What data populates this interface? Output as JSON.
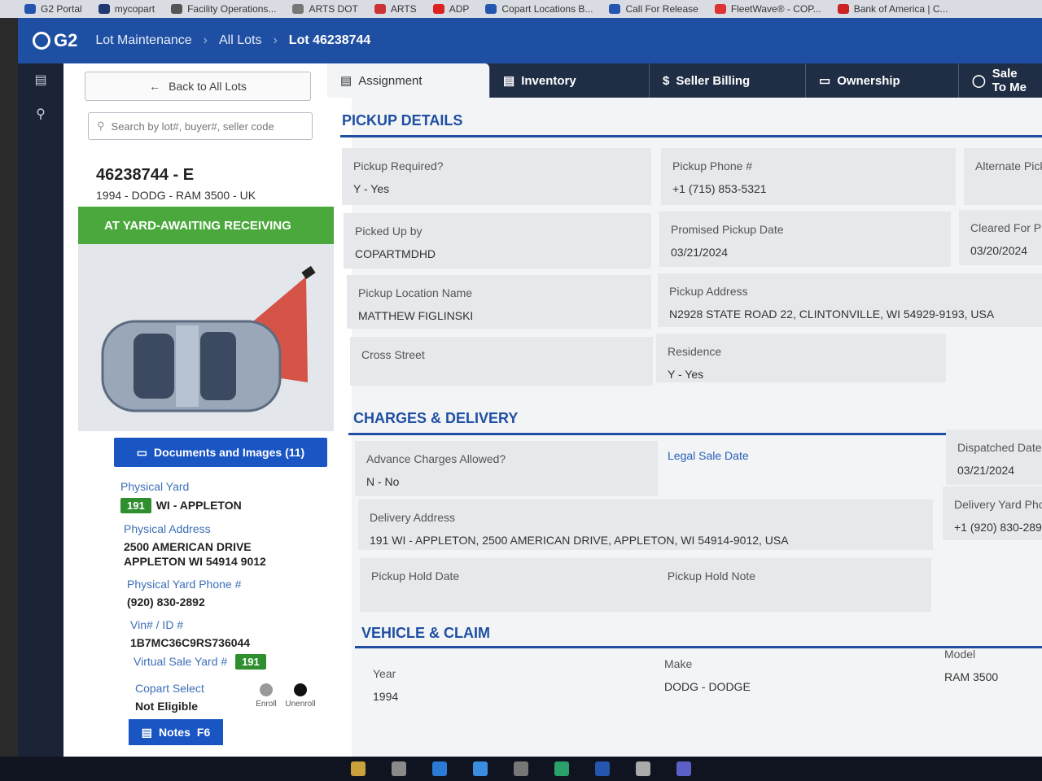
{
  "bookmarks": [
    "G2 Portal",
    "mycopart",
    "Facility Operations...",
    "ARTS DOT",
    "ARTS",
    "ADP",
    "Copart Locations B...",
    "Call For Release",
    "FleetWave® - COP...",
    "Bank of America | C..."
  ],
  "header": {
    "logo": "G2",
    "breadcrumbs": [
      "Lot Maintenance",
      "All Lots"
    ],
    "current": "Lot 46238744"
  },
  "left": {
    "back_label": "Back to All Lots",
    "search_placeholder": "Search by lot#, buyer#, seller code",
    "lot_title": "46238744 - E",
    "lot_sub": "1994 - DODG - RAM 3500 - UK",
    "status": "AT YARD-AWAITING RECEIVING",
    "docs_label": "Documents and Images (11)",
    "physical_yard_label": "Physical Yard",
    "physical_yard_badge": "191",
    "physical_yard_value": "WI - APPLETON",
    "physical_address_label": "Physical Address",
    "physical_address_line1": "2500 AMERICAN DRIVE",
    "physical_address_line2": "APPLETON WI 54914 9012",
    "yard_phone_label": "Physical Yard Phone #",
    "yard_phone_value": "(920) 830-2892",
    "vin_label": "Vin# / ID #",
    "vin_value": "1B7MC36C9RS736044",
    "virtual_yard_label": "Virtual Sale Yard #",
    "virtual_yard_badge": "191",
    "copart_select_label": "Copart Select",
    "copart_select_value": "Not Eligible",
    "enroll_label": "Enroll",
    "unenroll_label": "Unenroll",
    "notes_label": "Notes",
    "notes_key": "F6"
  },
  "tabs": [
    {
      "label": "Assignment",
      "icon": "clipboard-icon"
    },
    {
      "label": "Inventory",
      "icon": "list-icon"
    },
    {
      "label": "Seller Billing",
      "icon": "dollar-icon"
    },
    {
      "label": "Ownership",
      "icon": "folder-icon"
    },
    {
      "label": "Sale To Me",
      "icon": "basket-icon"
    }
  ],
  "pickup": {
    "title": "PICKUP DETAILS",
    "required_label": "Pickup Required?",
    "required_value": "Y - Yes",
    "phone_label": "Pickup Phone #",
    "phone_value": "+1 (715) 853-5321",
    "alt_label": "Alternate Pick",
    "picked_by_label": "Picked Up by",
    "picked_by_value": "COPARTMDHD",
    "promised_label": "Promised Pickup Date",
    "promised_value": "03/21/2024",
    "cleared_label": "Cleared For Pic",
    "cleared_value": "03/20/2024",
    "location_name_label": "Pickup Location Name",
    "location_name_value": "MATTHEW FIGLINSKI",
    "address_label": "Pickup Address",
    "address_value": "N2928 STATE ROAD 22, CLINTONVILLE, WI 54929-9193, USA",
    "cross_label": "Cross Street",
    "residence_label": "Residence",
    "residence_value": "Y - Yes"
  },
  "charges": {
    "title": "CHARGES & DELIVERY",
    "advance_label": "Advance Charges Allowed?",
    "advance_value": "N - No",
    "legal_label": "Legal Sale Date",
    "dispatched_label": "Dispatched Date",
    "dispatched_value": "03/21/2024",
    "delivery_addr_label": "Delivery Address",
    "delivery_addr_value": "191 WI - APPLETON, 2500 AMERICAN DRIVE, APPLETON, WI 54914-9012, USA",
    "delivery_phone_label": "Delivery Yard Phon",
    "delivery_phone_value": "+1 (920) 830-289",
    "hold_date_label": "Pickup Hold Date",
    "hold_note_label": "Pickup Hold Note"
  },
  "vehicle": {
    "title": "VEHICLE & CLAIM",
    "year_label": "Year",
    "year_value": "1994",
    "make_label": "Make",
    "make_value": "DODG - DODGE",
    "model_label": "Model",
    "model_value": "RAM 3500"
  }
}
